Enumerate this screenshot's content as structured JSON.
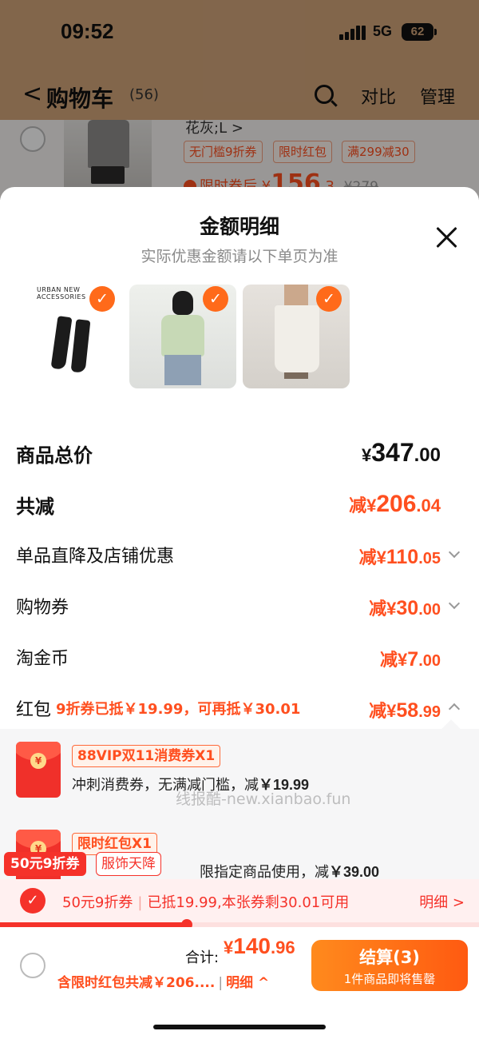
{
  "status": {
    "time": "09:52",
    "network": "5G",
    "battery": "62"
  },
  "nav": {
    "back": "<",
    "title": "购物车",
    "count": "(56)",
    "compare": "对比",
    "manage": "管理"
  },
  "cart_item": {
    "variant": "花灰;L >",
    "tags": [
      "无门槛9折券",
      "限时红包",
      "满299减30"
    ],
    "price_label": "限时券后",
    "price_currency": "¥",
    "price_int": "156",
    "price_dec": ".3",
    "orig_price": "¥279"
  },
  "sheet": {
    "title": "金额明细",
    "subtitle": "实际优惠金额请以下单页为准",
    "thumb_brand": "URBAN NEW ACCESSORIES",
    "check_mark": "✓",
    "rows": {
      "total": {
        "label": "商品总价",
        "currency": "¥",
        "int": "347",
        "dec": ".00"
      },
      "reduce": {
        "label": "共减",
        "prefix": "减¥",
        "int": "206",
        "dec": ".04"
      },
      "shop": {
        "label": "单品直降及店铺优惠",
        "prefix": "减¥",
        "int": "110",
        "dec": ".05"
      },
      "voucher": {
        "label": "购物券",
        "prefix": "减¥",
        "int": "30",
        "dec": ".00"
      },
      "coins": {
        "label": "淘金币",
        "prefix": "减¥",
        "int": "7",
        "dec": ".00"
      },
      "hongbao": {
        "label": "红包",
        "note": "9折券已抵￥19.99，可再抵￥30.01",
        "prefix": "减¥",
        "int": "58",
        "dec": ".99"
      }
    }
  },
  "coupons": [
    {
      "tag": "88VIP双11消费券X1",
      "desc": "冲刺消费券，无满减门槛，减",
      "amount": "￥19.99",
      "coin": "¥"
    },
    {
      "tag": "限时红包X1",
      "desc": "限指定商品使用，减",
      "amount": "￥39.00",
      "coin": "¥"
    }
  ],
  "watermark": "线报酷-new.xianbao.fun",
  "promo": {
    "pill1": "50元9折券",
    "pill2": "服饰天降",
    "check_mark": "✓",
    "strip_coupon": "50元9折券",
    "strip_divider": "|",
    "strip_info": "已抵19.99,本张券剩30.01可用",
    "detail": "明细 >",
    "progress": 0.39
  },
  "footer": {
    "total_label": "合计:",
    "currency": "¥",
    "total_int": "140",
    "total_dec": ".96",
    "saving": "含限时红包共减￥206....",
    "divider": "|",
    "detail": "明细 ^",
    "checkout_label": "结算(3)",
    "checkout_sub": "1件商品即将售罄"
  },
  "colors": {
    "accent": "#ff4f1f",
    "red": "#f5322a",
    "orange": "#ff6a1a"
  }
}
